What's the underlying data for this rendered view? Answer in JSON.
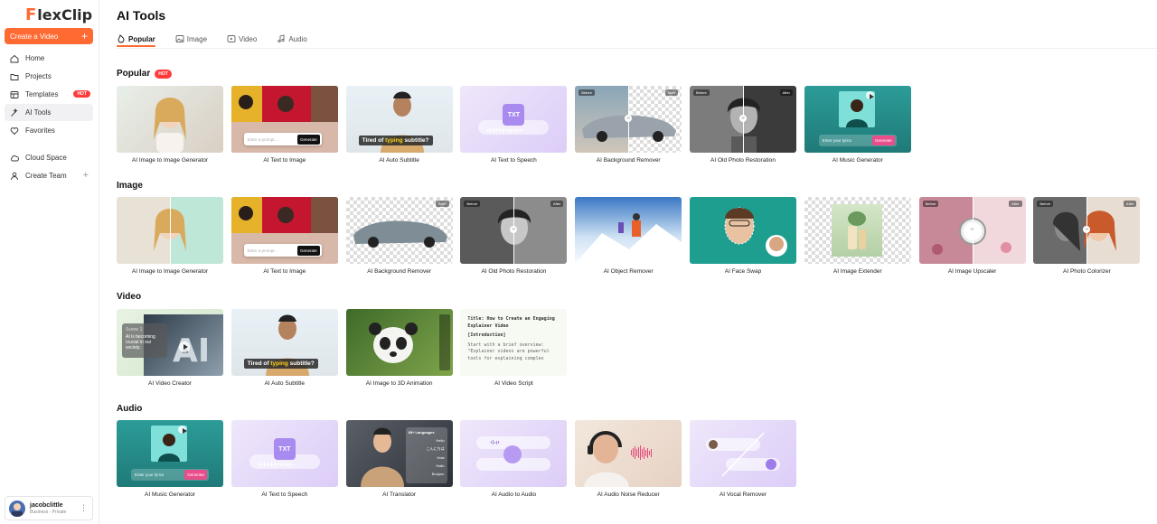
{
  "logo": {
    "f": "F",
    "rest": "lexClip"
  },
  "sidebar": {
    "create_label": "Create a Video",
    "items": [
      {
        "label": "Home",
        "icon": "home-icon"
      },
      {
        "label": "Projects",
        "icon": "folder-icon"
      },
      {
        "label": "Templates",
        "icon": "templates-icon",
        "badge": "HOT"
      },
      {
        "label": "AI Tools",
        "icon": "ai-tools-icon",
        "active": true
      },
      {
        "label": "Favorites",
        "icon": "heart-icon"
      },
      {
        "label": "Cloud Space",
        "icon": "cloud-icon"
      },
      {
        "label": "Create Team",
        "icon": "team-icon"
      }
    ],
    "account": {
      "name": "jacobclittle",
      "plan": "Business - Private"
    }
  },
  "page_title": "AI Tools",
  "tabs": [
    {
      "label": "Popular",
      "icon": "fire-icon"
    },
    {
      "label": "Image",
      "icon": "image-icon"
    },
    {
      "label": "Video",
      "icon": "video-icon"
    },
    {
      "label": "Audio",
      "icon": "audio-icon"
    }
  ],
  "sections": {
    "popular": {
      "title": "Popular",
      "badge": "HOT",
      "cards": [
        "AI Image to Image Generator",
        "AI Text to Image",
        "AI Auto Subtitle",
        "AI Text to Speech",
        "AI Background Remover",
        "AI Old Photo Restoration",
        "AI Music Generator"
      ]
    },
    "image": {
      "title": "Image",
      "cards": [
        "AI Image to Image Generator",
        "AI Text to Image",
        "AI Background Remover",
        "AI Old Photo Restoration",
        "AI Object Remover",
        "AI Face Swap",
        "AI Image Extender",
        "AI Image Upscaler",
        "AI Photo Colorizer"
      ]
    },
    "video": {
      "title": "Video",
      "cards": [
        "AI Video Creator",
        "AI Auto Subtitle",
        "AI Image to 3D Animation",
        "AI Video Script"
      ]
    },
    "audio": {
      "title": "Audio",
      "cards": [
        "AI Music Generator",
        "AI Text to Speech",
        "AI Translator",
        "AI Audio to Audio",
        "AI Audio Noise Reducer",
        "AI Vocal Remover"
      ]
    }
  },
  "thumb_text": {
    "before": "Before",
    "after": "After",
    "prompt_placeholder": "Enter a prompt...",
    "generate": "Generate",
    "lyrics_placeholder": "Enter your lyrics",
    "subtitle_a": "Tired of ",
    "subtitle_b": "typing",
    "subtitle_c": " subtitle?",
    "txt": "TXT",
    "languages_title": "80+ Languages",
    "langs": [
      "Hello",
      "こんにちは",
      "Hola",
      "Hallo",
      "Bonjour"
    ],
    "video_caption_title": "Scene 1",
    "video_caption": "AI is becoming crucial in our society.",
    "script_title": "Title: How to Create an Engaging Explainer Video",
    "script_intro": "[Introduction]",
    "script_body": "Start with a brief overview: \"Explainer videos are powerful tools for explaining complex"
  },
  "colors": {
    "accent": "#ff6a32",
    "hot": "#ff3b3b"
  }
}
